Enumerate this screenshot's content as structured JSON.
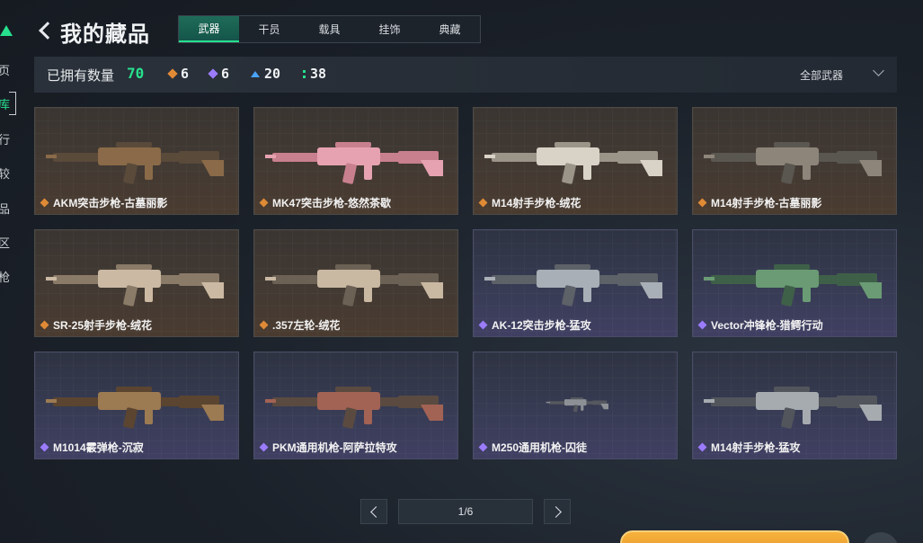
{
  "nav": {
    "items": [
      "页",
      "库",
      "行",
      "较",
      "品",
      "区",
      "枪"
    ],
    "active_index": 1
  },
  "header": {
    "title": "我的藏品"
  },
  "tabs": [
    {
      "label": "武器",
      "active": true
    },
    {
      "label": "干员",
      "active": false
    },
    {
      "label": "载具",
      "active": false
    },
    {
      "label": "挂饰",
      "active": false
    },
    {
      "label": "典藏",
      "active": false
    }
  ],
  "stats": {
    "label": "已拥有数量",
    "total": "70",
    "orange": "6",
    "purple": "6",
    "blue": "20",
    "green": "38"
  },
  "filter": {
    "label": "全部武器"
  },
  "items": [
    {
      "name": "AKM突击步枪-古墓丽影",
      "rarity": "gold"
    },
    {
      "name": "MK47突击步枪-悠然茶歇",
      "rarity": "gold"
    },
    {
      "name": "M14射手步枪-绒花",
      "rarity": "gold"
    },
    {
      "name": "M14射手步枪-古墓丽影",
      "rarity": "gold"
    },
    {
      "name": "SR-25射手步枪-绒花",
      "rarity": "gold"
    },
    {
      "name": ".357左轮-绒花",
      "rarity": "gold"
    },
    {
      "name": "AK-12突击步枪-猛攻",
      "rarity": "purple"
    },
    {
      "name": "Vector冲锋枪-猎鳄行动",
      "rarity": "purple"
    },
    {
      "name": "M1014霰弹枪-沉寂",
      "rarity": "purple"
    },
    {
      "name": "PKM通用机枪-阿萨拉特攻",
      "rarity": "purple"
    },
    {
      "name": "M250通用机枪-囚徒",
      "rarity": "purple"
    },
    {
      "name": "M14射手步枪-猛攻",
      "rarity": "purple"
    }
  ],
  "pagination": {
    "indicator": "1/6"
  },
  "colors": {
    "accent": "#27e08e",
    "gold": "#e08a36",
    "purple": "#9b7cff",
    "blue": "#4aa3ff"
  }
}
